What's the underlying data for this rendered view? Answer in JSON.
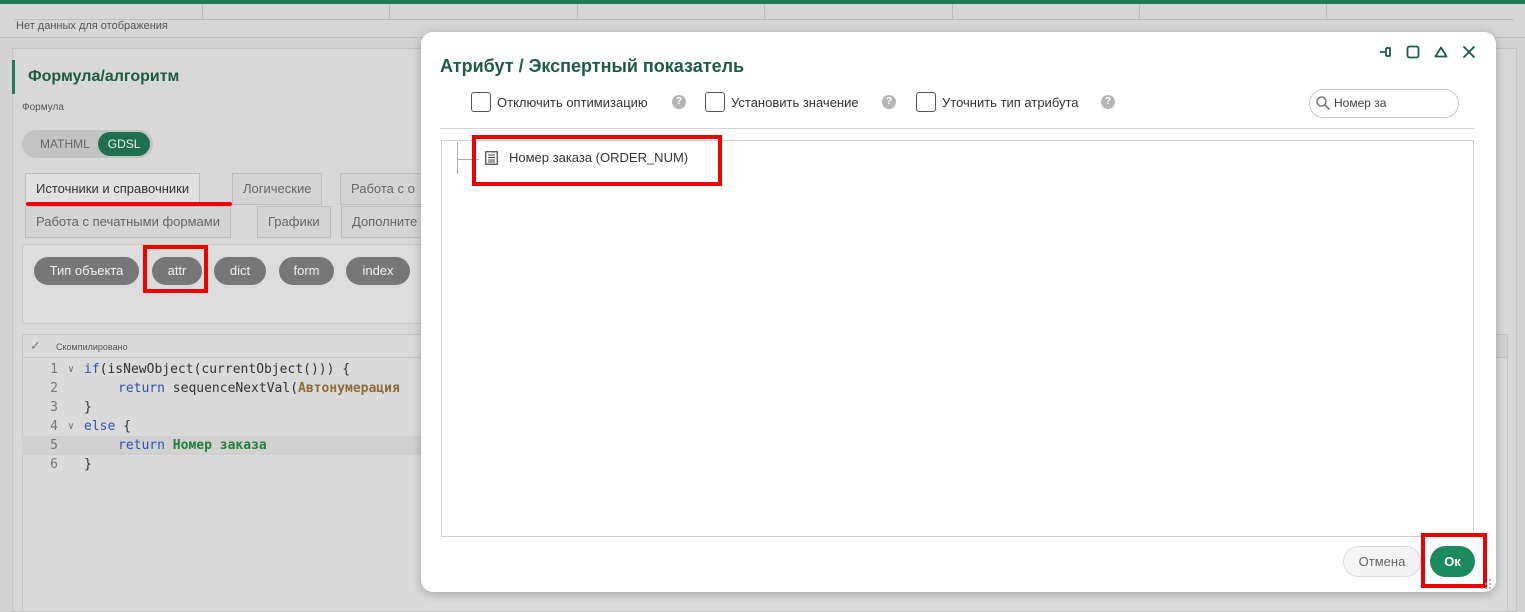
{
  "background": {
    "table": {
      "empty_text": "Нет данных для отображения"
    },
    "section_title": "Формула/алгоритм",
    "field_label": "Формула",
    "mode_toggle": {
      "options": [
        "MATHML",
        "GDSL"
      ],
      "selected": "GDSL"
    },
    "function_tabs": [
      "Источники и справочники",
      "Логические",
      "Работа с о",
      "Работа с печатными формами",
      "Графики",
      "Дополните"
    ],
    "active_tab": "Источники и справочники",
    "chips": [
      "Тип объекта",
      "attr",
      "dict",
      "form",
      "index"
    ],
    "editor": {
      "status": "Скомпилировано",
      "lines": [
        {
          "n": "1",
          "kw": "if",
          "rest": "(isNewObject(currentObject())) {"
        },
        {
          "n": "2",
          "kw": "return",
          "rest": " sequenceNextVal(",
          "bold": "Автонумерация"
        },
        {
          "n": "3",
          "text": "}"
        },
        {
          "n": "4",
          "kw": "else",
          "rest": " {"
        },
        {
          "n": "5",
          "kw": "return",
          "bold": "Номер заказа"
        },
        {
          "n": "6",
          "text": "}"
        }
      ]
    }
  },
  "dialog": {
    "title": "Атрибут / Экспертный показатель",
    "options": [
      {
        "label": "Отключить оптимизацию",
        "checked": false
      },
      {
        "label": "Установить значение",
        "checked": false
      },
      {
        "label": "Уточнить тип атрибута",
        "checked": false
      }
    ],
    "help_glyph": "?",
    "search": {
      "value": "Номер за"
    },
    "tree": [
      {
        "label": "Номер заказа (ORDER_NUM)",
        "icon": "list-icon"
      }
    ],
    "buttons": {
      "cancel": "Отмена",
      "ok": "Ок"
    },
    "window_controls": [
      "pin-icon",
      "maximize-icon",
      "collapse-icon",
      "close-icon"
    ]
  },
  "colors": {
    "brand_green": "#1d5c43",
    "ok_green": "#1b8a5e",
    "highlight_red": "#ee0000"
  }
}
